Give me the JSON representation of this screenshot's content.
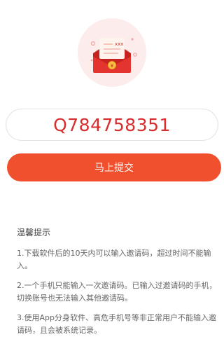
{
  "hero": {
    "icon": "red-envelope-icon",
    "envelope_text": "xxx",
    "colors": {
      "circle": "#fdecec",
      "envelope": "#e3342f",
      "paper": "#fff3ee",
      "coin": "#f7c243"
    }
  },
  "invite": {
    "code": "Q784758351",
    "code_color": "#d72d2d"
  },
  "submit": {
    "label": "马上提交",
    "color": "#f0502d"
  },
  "tips": {
    "title": "温馨提示",
    "items": [
      "1.下载软件后的10天内可以输入邀请码，超过时间不能输入。",
      "2.一个手机只能输入一次邀请码。已输入过邀请码的手机，切换账号也无法输入其他邀请码。",
      "3.使用App分身软件、高危手机号等非正常用户不能输入邀请码，且会被系统记录。"
    ]
  }
}
